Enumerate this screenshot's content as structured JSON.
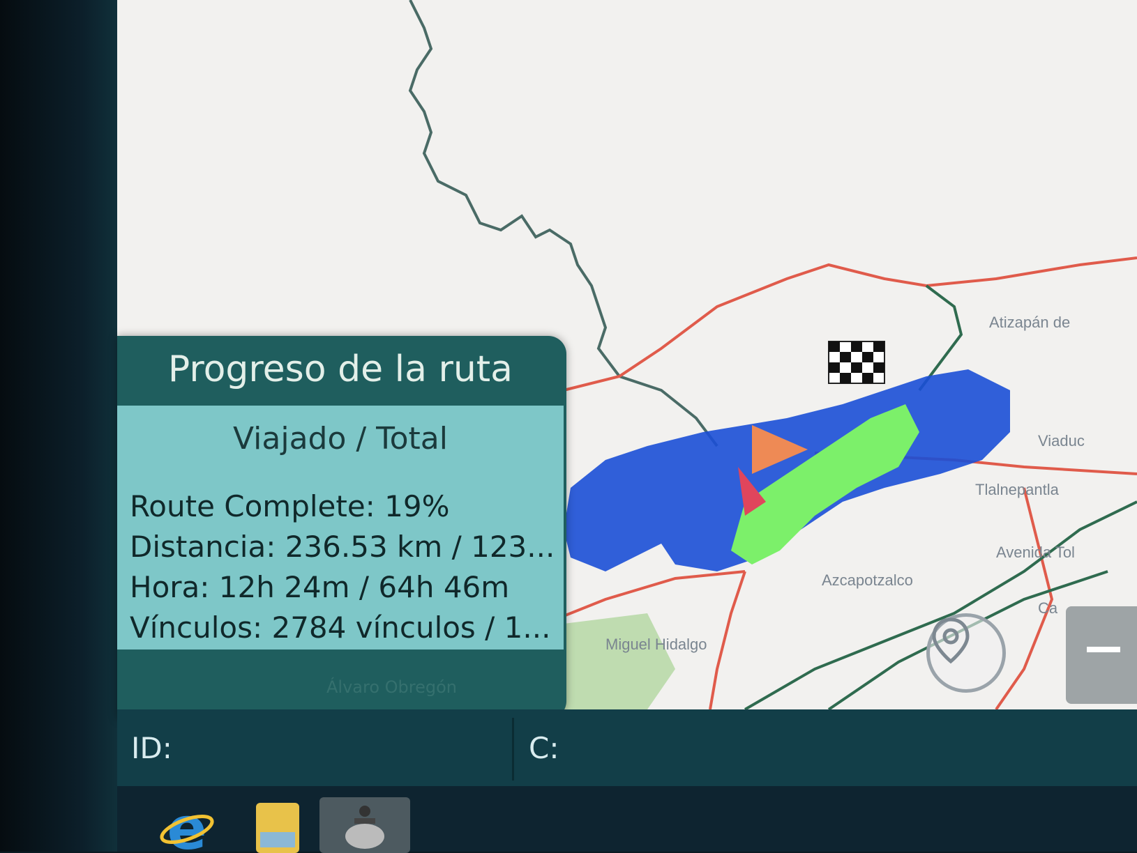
{
  "map": {
    "labels": {
      "atizapan": "Atizapán de",
      "viaduct": "Viaduc",
      "tlalnepantla": "Tlalnepantla",
      "avenida": "Avenida Tol",
      "azcapotzalco": "Azcapotzalco",
      "miguel_hidalgo": "Miguel Hidalgo",
      "alvaro_obregon": "Álvaro Obregón",
      "ca": "Ca"
    },
    "colors": {
      "background": "#f2f1ef",
      "border_line": "#4a6b66",
      "highway": "#e05b4b",
      "road": "#2f6b4f",
      "coverage": "#1b4fd6",
      "traveled": "#7cf06a",
      "start_marker": "#ee8a55",
      "current_marker": "#e0455c",
      "park": "#bfdcb0"
    },
    "icons": {
      "finish": "checkered-flag-icon",
      "current_position": "position-arrow-icon",
      "start": "start-arrow-icon",
      "locate": "locate-pin-icon",
      "zoom_out": "minus-icon"
    }
  },
  "route_progress": {
    "title": "Progreso de la ruta",
    "subtitle": "Viajado / Total",
    "route_complete": "Route Complete: 19%",
    "distance": "Distancia: 236.53 km / 123...",
    "time": "Hora: 12h 24m / 64h 46m",
    "links": "Vínculos: 2784 vínculos / 1...",
    "percent_complete": 19
  },
  "status_bar": {
    "id_label": "ID:",
    "c_label": "C:"
  },
  "taskbar": {
    "items": [
      "internet-explorer-icon",
      "folder-icon",
      "app-icon"
    ]
  }
}
